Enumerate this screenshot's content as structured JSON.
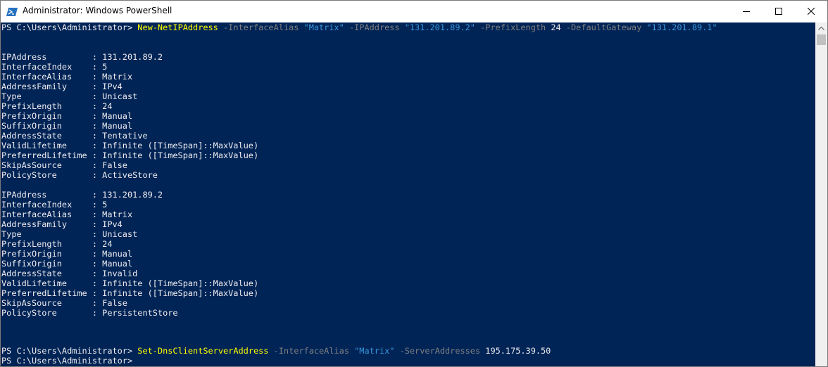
{
  "window": {
    "title": "Administrator: Windows PowerShell"
  },
  "colors": {
    "console_bg": "#012456",
    "text": "#eeedf0",
    "cmdlet": "#ffff00",
    "parameter": "#808080",
    "string": "#3a96dd"
  },
  "icons": {
    "app": "powershell-icon",
    "minimize": "minimize-icon",
    "maximize": "maximize-icon",
    "close": "close-icon",
    "scroll_up": "scroll-up-icon"
  },
  "command1": {
    "prompt": "PS C:\\Users\\Administrator> ",
    "cmdlet": "New-NetIPAddress",
    "p1": " -InterfaceAlias ",
    "v1": "\"Matrix\"",
    "p2": " -IPAddress ",
    "v2": "\"131.201.89.2\"",
    "p3": " -PrefixLength ",
    "v3": "24",
    "p4": " -DefaultGateway ",
    "v4": "\"131.201.89.1\""
  },
  "block1": [
    "IPAddress         : 131.201.89.2",
    "InterfaceIndex    : 5",
    "InterfaceAlias    : Matrix",
    "AddressFamily     : IPv4",
    "Type              : Unicast",
    "PrefixLength      : 24",
    "PrefixOrigin      : Manual",
    "SuffixOrigin      : Manual",
    "AddressState      : Tentative",
    "ValidLifetime     : Infinite ([TimeSpan]::MaxValue)",
    "PreferredLifetime : Infinite ([TimeSpan]::MaxValue)",
    "SkipAsSource      : False",
    "PolicyStore       : ActiveStore"
  ],
  "block2": [
    "IPAddress         : 131.201.89.2",
    "InterfaceIndex    : 5",
    "InterfaceAlias    : Matrix",
    "AddressFamily     : IPv4",
    "Type              : Unicast",
    "PrefixLength      : 24",
    "PrefixOrigin      : Manual",
    "SuffixOrigin      : Manual",
    "AddressState      : Invalid",
    "ValidLifetime     : Infinite ([TimeSpan]::MaxValue)",
    "PreferredLifetime : Infinite ([TimeSpan]::MaxValue)",
    "SkipAsSource      : False",
    "PolicyStore       : PersistentStore"
  ],
  "command2": {
    "prompt": "PS C:\\Users\\Administrator> ",
    "cmdlet": "Set-DnsClientServerAddress",
    "p1": " -InterfaceAlias ",
    "v1": "\"Matrix\"",
    "p2": " -ServerAddresses ",
    "v2": "195.175.39.50"
  },
  "command3": {
    "prompt": "PS C:\\Users\\Administrator>"
  }
}
